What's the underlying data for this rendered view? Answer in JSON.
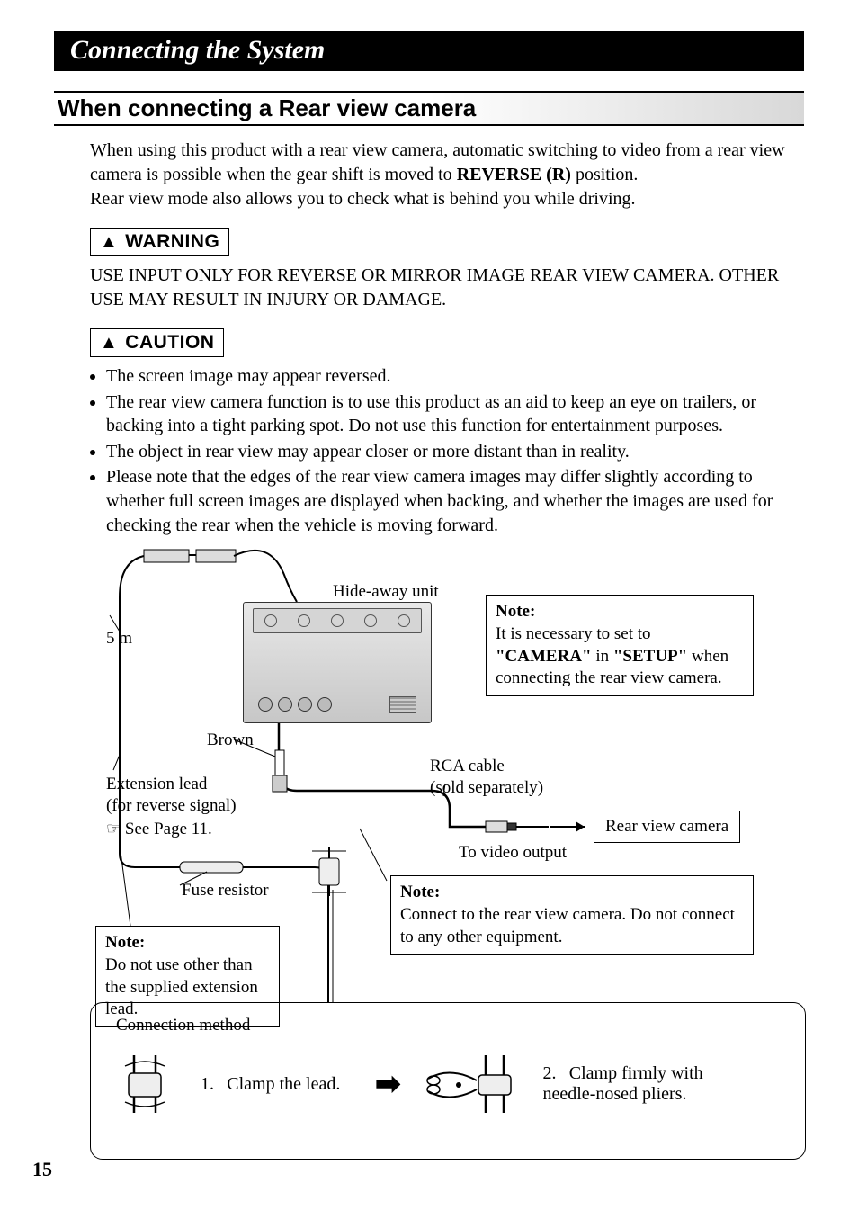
{
  "chapter_title": "Connecting the System",
  "section_title": "When connecting a Rear view camera",
  "intro": {
    "line1a": "When using this product with a rear view camera, automatic switching to video from a rear view camera is possible when the gear shift is moved to ",
    "reverse_bold": "REVERSE (R)",
    "line1b": " position.",
    "line2": "Rear view mode also allows you to check what is behind you while driving."
  },
  "warning": {
    "label": "WARNING",
    "body": "USE INPUT ONLY FOR REVERSE OR MIRROR IMAGE REAR VIEW CAMERA. OTHER USE MAY RESULT IN INJURY OR DAMAGE."
  },
  "caution": {
    "label": "CAUTION",
    "items": [
      "The screen image may appear reversed.",
      "The rear view camera function is to use this product as an aid to keep an eye on trailers, or backing into a tight parking spot. Do not use this function for entertainment purposes.",
      "The object in rear view may appear closer or more distant than in reality.",
      "Please note that the edges of the rear view camera images may differ slightly according to whether full screen images are displayed when backing, and whether the images are used for checking the rear when the vehicle is moving forward."
    ]
  },
  "diagram": {
    "hideaway_label": "Hide-away unit",
    "five_m": "5 m",
    "brown": "Brown",
    "extension_lead_l1": "Extension lead",
    "extension_lead_l2": "(for reverse signal)",
    "see_page": "See Page 11.",
    "pointer_glyph": "☞",
    "fuse_resistor": "Fuse resistor",
    "rca_l1": "RCA cable",
    "rca_l2": "(sold separately)",
    "to_video_output": "To video output",
    "rear_view_camera": "Rear view camera",
    "note1": {
      "heading": "Note:",
      "t1": "It is necessary to set to ",
      "b1": "\"CAMERA\"",
      "t2": " in ",
      "b2": "\"SETUP\"",
      "t3": " when connecting the rear view camera."
    },
    "note2": {
      "heading": "Note:",
      "body": "Connect to the rear view camera. Do not connect to any other equipment."
    },
    "note3": {
      "heading": "Note:",
      "body": "Do not use other than the supplied extension lead."
    }
  },
  "method": {
    "title": "Connection method",
    "step1_num": "1.",
    "step1": "Clamp the lead.",
    "step2_num": "2.",
    "step2": "Clamp firmly with needle-nosed pliers.",
    "arrow": "➡"
  },
  "page_number": "15"
}
